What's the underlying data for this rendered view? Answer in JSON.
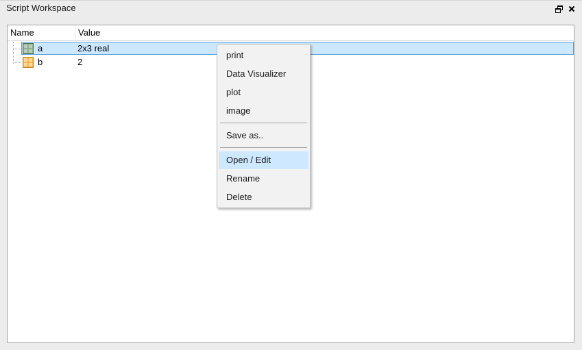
{
  "window": {
    "title": "Script Workspace",
    "restore_icon": "restore-window-icon",
    "close_icon": "close-icon"
  },
  "tree": {
    "columns": [
      "Name",
      "Value"
    ],
    "rows": [
      {
        "name": "a",
        "value": "2x3 real",
        "icon": "matrix-variable-icon",
        "icon_color": "#6b8f6b",
        "selected": true
      },
      {
        "name": "b",
        "value": "2",
        "icon": "scalar-variable-icon",
        "icon_color": "#e8a030",
        "selected": false
      }
    ]
  },
  "context_menu": {
    "groups": [
      [
        "print",
        "Data Visualizer",
        "plot",
        "image"
      ],
      [
        "Save as.."
      ],
      [
        "Open / Edit",
        "Rename",
        "Delete"
      ]
    ],
    "highlighted": "Open / Edit"
  },
  "colors": {
    "selection_bg": "#cce8ff",
    "selection_border": "#5aa0dc",
    "menu_highlight": "#cde8ff"
  }
}
